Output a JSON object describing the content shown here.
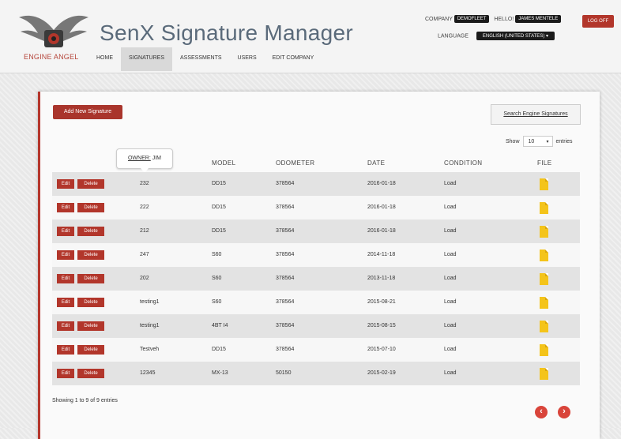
{
  "logo": {
    "text": "ENGINE ANGEL"
  },
  "app_title": "SenX Signature Manager",
  "nav": [
    {
      "label": "HOME",
      "active": false
    },
    {
      "label": "SIGNATURES",
      "active": true
    },
    {
      "label": "ASSESSMENTS",
      "active": false
    },
    {
      "label": "USERS",
      "active": false
    },
    {
      "label": "EDIT COMPANY",
      "active": false
    }
  ],
  "user_bar": {
    "company_label": "COMPANY",
    "company_value": "DEMOFLEET",
    "hello_label": "HELLO!",
    "user_value": "JAMES MENTELE",
    "logoff_label": "LOG OFF",
    "language_label": "LANGUAGE",
    "language_value": "ENGLISH (UNITED STATES) ▾"
  },
  "toolbar": {
    "add_label": "Add New Signature",
    "search_label": "Search Engine Signatures",
    "show_label": "Show",
    "show_value": "10",
    "entries_label": "entries"
  },
  "owner_tooltip": {
    "label": "OWNER:",
    "value": "JIM"
  },
  "table": {
    "columns": [
      "MODEL",
      "ODOMETER",
      "DATE",
      "CONDITION",
      "FILE"
    ],
    "edit_label": "Edit",
    "delete_label": "Delete",
    "rows": [
      {
        "id": "232",
        "model": "DD15",
        "odometer": "378564",
        "date": "2016-01-18",
        "condition": "Load"
      },
      {
        "id": "222",
        "model": "DD15",
        "odometer": "378564",
        "date": "2016-01-18",
        "condition": "Load"
      },
      {
        "id": "212",
        "model": "DD15",
        "odometer": "378564",
        "date": "2016-01-18",
        "condition": "Load"
      },
      {
        "id": "247",
        "model": "S60",
        "odometer": "378564",
        "date": "2014-11-18",
        "condition": "Load"
      },
      {
        "id": "202",
        "model": "S60",
        "odometer": "378564",
        "date": "2013-11-18",
        "condition": "Load"
      },
      {
        "id": "testing1",
        "model": "S60",
        "odometer": "378564",
        "date": "2015-08-21",
        "condition": "Load"
      },
      {
        "id": "testing1",
        "model": "4BT I4",
        "odometer": "378564",
        "date": "2015-08-15",
        "condition": "Load"
      },
      {
        "id": "Testveh",
        "model": "DD15",
        "odometer": "378564",
        "date": "2015-07-10",
        "condition": "Load"
      },
      {
        "id": "12345",
        "model": "MX-13",
        "odometer": "50150",
        "date": "2015-02-19",
        "condition": "Load"
      }
    ]
  },
  "footer": {
    "showing": "Showing 1 to 9 of 9 entries",
    "prev_icon": "arrow-left",
    "next_icon": "arrow-right"
  },
  "colors": {
    "accent": "#b2362b",
    "file": "#f4c41a",
    "title": "#5a6a7a"
  }
}
